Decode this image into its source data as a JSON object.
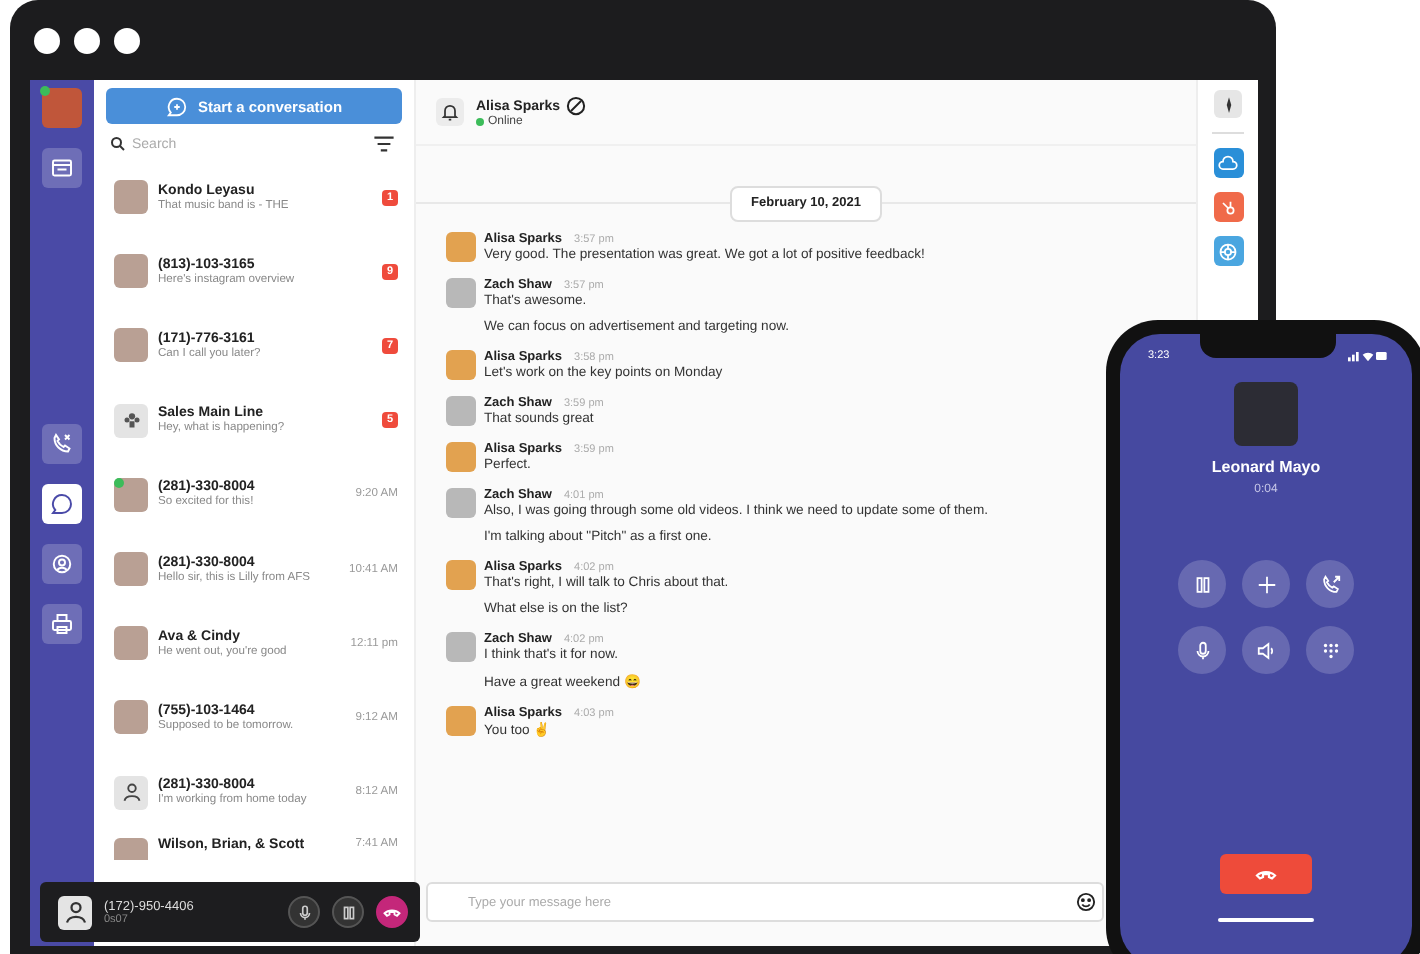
{
  "rail": {
    "profile": {
      "online": true
    },
    "items": [
      {
        "kind": "calendar",
        "selected": false
      },
      {
        "kind": "calls",
        "selected": false
      },
      {
        "kind": "chat",
        "selected": true
      },
      {
        "kind": "contacts",
        "selected": false
      },
      {
        "kind": "fax",
        "selected": false
      }
    ]
  },
  "conversation_list": {
    "start_button": "Start a conversation",
    "search": {
      "placeholder": "Search"
    },
    "items": [
      {
        "name": "Kondo Leyasu",
        "preview": "That music band is - THE",
        "badge": "1",
        "kind": "photo",
        "online": false
      },
      {
        "name": "(813)-103-3165",
        "preview": "Here's instagram overview",
        "badge": "9",
        "kind": "photo",
        "online": false
      },
      {
        "name": "(171)-776-3161",
        "preview": "Can I call you later?",
        "badge": "7",
        "kind": "photo",
        "online": false
      },
      {
        "name": "Sales Main Line",
        "preview": "Hey, what is happening?",
        "badge": "5",
        "kind": "group",
        "online": false
      },
      {
        "name": "(281)-330-8004",
        "preview": "So excited for this!",
        "time": "9:20 AM",
        "kind": "photo",
        "online": true
      },
      {
        "name": "(281)-330-8004",
        "preview": "Hello sir, this is Lilly from AFS",
        "time": "10:41 AM",
        "kind": "photo",
        "online": false
      },
      {
        "name": "Ava & Cindy",
        "preview": "He went out, you're good",
        "time": "12:11 pm",
        "kind": "photo",
        "online": false
      },
      {
        "name": "(755)-103-1464",
        "preview": "Supposed to be tomorrow.",
        "time": "9:12 AM",
        "kind": "photo",
        "online": false
      },
      {
        "name": "(281)-330-8004",
        "preview": "I'm working from home today",
        "time": "8:12 AM",
        "kind": "person",
        "online": false
      },
      {
        "name": "Wilson, Brian, & Scott",
        "time": "7:41 AM",
        "kind": "photo",
        "online": false
      }
    ]
  },
  "chat": {
    "contact": "Alisa Sparks",
    "status": "Online",
    "date": "February 10, 2021",
    "messages": [
      {
        "sender": "Alisa Sparks",
        "time": "3:57 pm",
        "lines": [
          "Very good. The presentation was great. We got a lot of positive feedback!"
        ]
      },
      {
        "sender": "Zach Shaw",
        "time": "3:57 pm",
        "lines": [
          "That's awesome.",
          "We can focus on advertisement and targeting now."
        ]
      },
      {
        "sender": "Alisa Sparks",
        "time": "3:58 pm",
        "lines": [
          "Let's work on the key points on Monday"
        ]
      },
      {
        "sender": "Zach Shaw",
        "time": "3:59 pm",
        "lines": [
          "That sounds great"
        ]
      },
      {
        "sender": "Alisa Sparks",
        "time": "3:59 pm",
        "lines": [
          "Perfect."
        ]
      },
      {
        "sender": "Zach Shaw",
        "time": "4:01 pm",
        "lines": [
          "Also, I was going through some old videos. I think we need to update some of them.",
          "I'm talking about \"Pitch\" as a first one."
        ]
      },
      {
        "sender": "Alisa Sparks",
        "time": "4:02 pm",
        "lines": [
          "That's right, I will talk to Chris about that.",
          "What else is on the list?"
        ]
      },
      {
        "sender": "Zach Shaw",
        "time": "4:02 pm",
        "lines": [
          "I think that's it for now.",
          "Have a great weekend 😄"
        ]
      },
      {
        "sender": "Alisa Sparks",
        "time": "4:03 pm",
        "lines": [
          "You too ✌"
        ]
      }
    ],
    "composer": {
      "placeholder": "Type your message here"
    }
  },
  "apps": [
    {
      "kind": "cloud",
      "color": "#2a8fd8"
    },
    {
      "kind": "hub",
      "color": "#f06a4a"
    },
    {
      "kind": "target",
      "color": "#4aa6e0"
    }
  ],
  "call_bar": {
    "number": "(172)-950-4406",
    "duration": "0s07"
  },
  "phone": {
    "time": "3:23",
    "caller": "Leonard Mayo",
    "duration": "0:04",
    "buttons": [
      {
        "kind": "pause"
      },
      {
        "kind": "add"
      },
      {
        "kind": "transfer"
      },
      {
        "kind": "mute"
      },
      {
        "kind": "speaker"
      },
      {
        "kind": "keypad"
      }
    ]
  }
}
